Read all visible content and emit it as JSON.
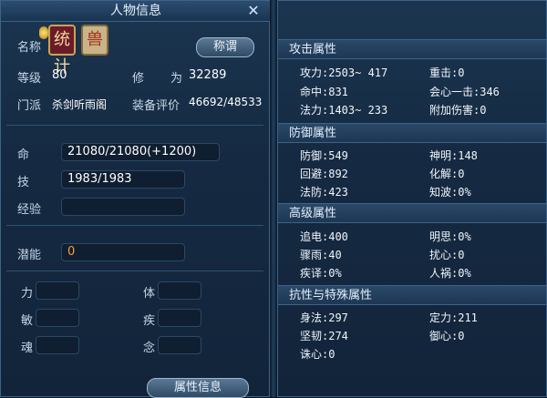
{
  "window": {
    "title": "人物信息",
    "close_icon": "close-icon"
  },
  "profile": {
    "name_label": "名称",
    "badge_1_text": "统计",
    "badge_2_text": "兽",
    "title_button": "称谓",
    "level_label": "等级",
    "level_value": "80",
    "cultivation_label": "修",
    "cultivation_label2": "为",
    "cultivation_value": "32289",
    "sect_label": "门派",
    "sect_value": "杀剑听雨阁",
    "equip_label": "装备评价",
    "equip_value": "46692/48533"
  },
  "vitals": {
    "life_label": "命",
    "life_value": "21080/21080(+1200)",
    "skill_label": "技",
    "skill_value": "1983/1983",
    "exp_label": "经验",
    "exp_value": "",
    "potential_label": "潜能",
    "potential_value": "0"
  },
  "attributes": [
    {
      "label": "力",
      "value": ""
    },
    {
      "label": "体",
      "value": ""
    },
    {
      "label": "敏",
      "value": ""
    },
    {
      "label": "疾",
      "value": ""
    },
    {
      "label": "魂",
      "value": ""
    },
    {
      "label": "念",
      "value": ""
    }
  ],
  "footer_button": "属性信息",
  "right": {
    "sections": [
      {
        "title": "攻击属性",
        "rows": [
          [
            "攻力:2503~ 417",
            "重击:0"
          ],
          [
            "命中:831",
            "会心一击:346"
          ],
          [
            "法力:1403~ 233",
            "附加伤害:0"
          ]
        ]
      },
      {
        "title": "防御属性",
        "rows": [
          [
            "防御:549",
            "神明:148"
          ],
          [
            "回避:892",
            "化解:0"
          ],
          [
            "法防:423",
            "知波:0%"
          ]
        ]
      },
      {
        "title": "高级属性",
        "rows": [
          [
            "追电:400",
            "明思:0%"
          ],
          [
            "骤雨:40",
            "扰心:0"
          ],
          [
            "疾译:0%",
            "人祸:0%"
          ]
        ]
      },
      {
        "title": "抗性与特殊属性",
        "rows": [
          [
            "身法:297",
            "定力:211"
          ],
          [
            "坚韧:274",
            "御心:0"
          ],
          [
            "诛心:0",
            ""
          ]
        ]
      }
    ]
  }
}
